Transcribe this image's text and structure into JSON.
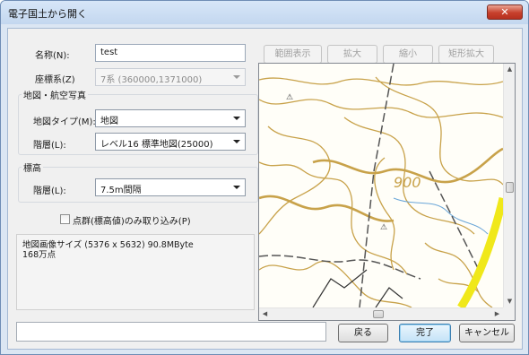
{
  "window": {
    "title": "電子国土から開く",
    "close_glyph": "✕"
  },
  "form": {
    "name_label": "名称(N):",
    "name_value": "test",
    "crs_label": "座標系(Z)",
    "crs_value": "7系 (360000,1371000)"
  },
  "map_group": {
    "title": "地図・航空写真",
    "type_label": "地図タイプ(M):",
    "type_value": "地図",
    "level_label": "階層(L):",
    "level_value": "レベル16 標準地図(25000)"
  },
  "elevation_group": {
    "title": "標高",
    "level_label": "階層(L):",
    "level_value": "7.5m間隔"
  },
  "point_checkbox": {
    "label": "点群(標高値)のみ取り込み(P)",
    "checked": false
  },
  "info": {
    "line1": "地図画像サイズ (5376 x 5632) 90.8MByte",
    "line2": "168万点"
  },
  "map_toolbar": {
    "range_label": "範囲表示",
    "zoom_in_label": "拡大",
    "zoom_out_label": "縮小",
    "rect_zoom_label": "矩形拡大"
  },
  "map_view": {
    "contour_label": "900",
    "contour_color": "#c8a24a",
    "road_color": "#f0e81a",
    "water_color": "#6aa6d8"
  },
  "footer": {
    "back_label": "戻る",
    "finish_label": "完了",
    "cancel_label": "キャンセル"
  }
}
